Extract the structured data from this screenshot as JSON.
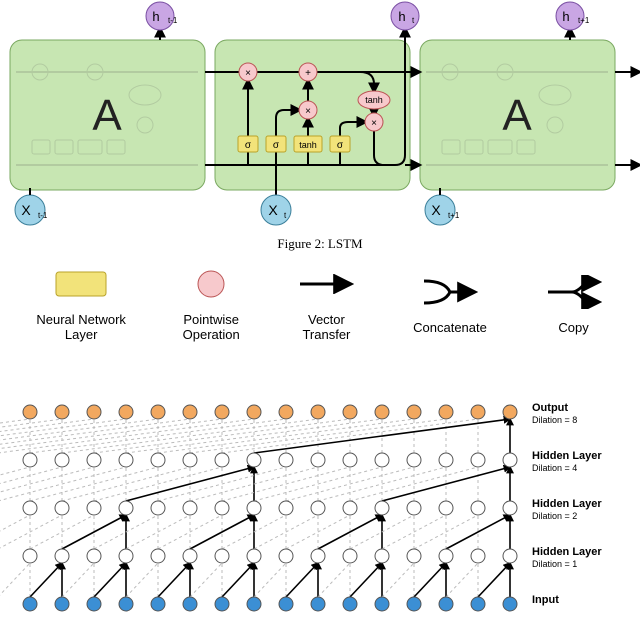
{
  "lstm": {
    "caption": "Figure 2: LSTM",
    "cells": [
      {
        "label": "A",
        "h_label": "h",
        "h_sub": "t-1",
        "x_label": "X",
        "x_sub": "t-1"
      },
      {
        "label_center": "",
        "h_label": "h",
        "h_sub": "t",
        "x_label": "X",
        "x_sub": "t",
        "gates": [
          "σ",
          "σ",
          "tanh",
          "σ"
        ],
        "topTanh": "tanh"
      },
      {
        "label": "A",
        "h_label": "h",
        "h_sub": "t+1",
        "x_label": "X",
        "x_sub": "t+1"
      }
    ]
  },
  "legend": {
    "layer": "Neural Network\nLayer",
    "pointwise": "Pointwise\nOperation",
    "transfer": "Vector\nTransfer",
    "concat": "Concatenate",
    "copy": "Copy"
  },
  "wavenet": {
    "cols": 16,
    "layers": [
      {
        "title": "Output",
        "sub": "Dilation = 8",
        "color": "#f2a85f",
        "dilation": 8
      },
      {
        "title": "Hidden Layer",
        "sub": "Dilation = 4",
        "color": "#ffffff",
        "dilation": 4
      },
      {
        "title": "Hidden Layer",
        "sub": "Dilation = 2",
        "color": "#ffffff",
        "dilation": 2
      },
      {
        "title": "Hidden Layer",
        "sub": "Dilation = 1",
        "color": "#ffffff",
        "dilation": 1
      },
      {
        "title": "Input",
        "sub": "",
        "color": "#3b8fd4",
        "dilation": 0
      }
    ]
  }
}
